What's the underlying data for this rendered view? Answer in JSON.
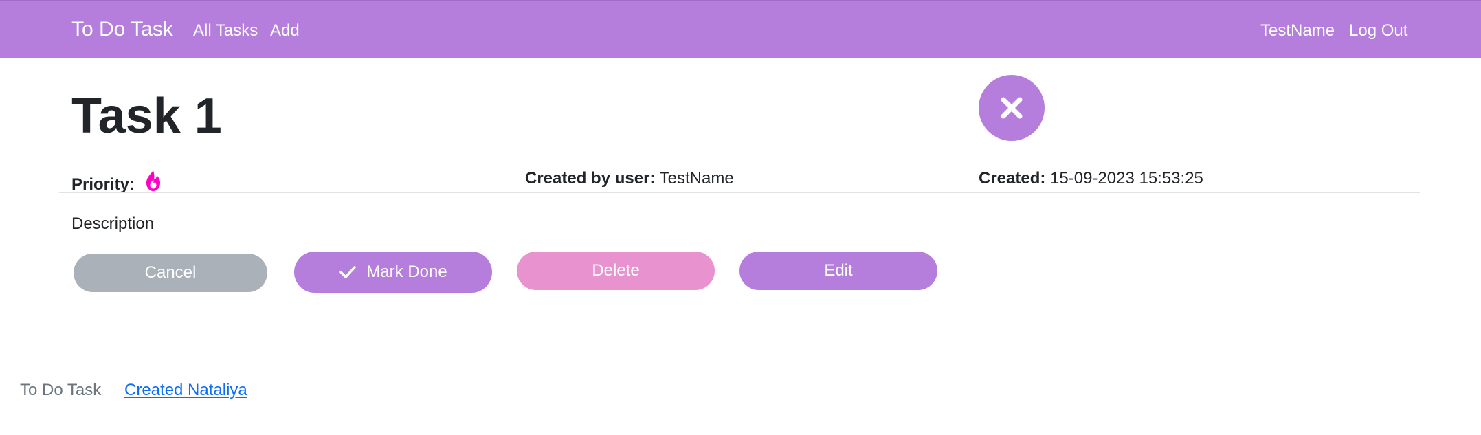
{
  "navbar": {
    "brand": "To Do Task",
    "links": [
      "All Tasks",
      "Add"
    ],
    "user": "TestName",
    "logout": "Log Out",
    "color": "#b57edc"
  },
  "task": {
    "title": "Task 1",
    "priority_label": "Priority:",
    "priority_icon": "flame-icon",
    "created_by_label": "Created by user:",
    "created_by_value": "TestName",
    "created_label": "Created:",
    "created_value": "15-09-2023 15:53:25",
    "description": "Description"
  },
  "buttons": {
    "cancel": "Cancel",
    "mark_done": "Mark Done",
    "delete": "Delete",
    "edit": "Edit"
  },
  "footer": {
    "brand": "To Do Task",
    "link": "Created Nataliya"
  },
  "colors": {
    "accent": "#b57edc",
    "delete": "#e893d0",
    "cancel": "#aab1b8",
    "flame": "#ff00c8",
    "link": "#0d6efd"
  }
}
